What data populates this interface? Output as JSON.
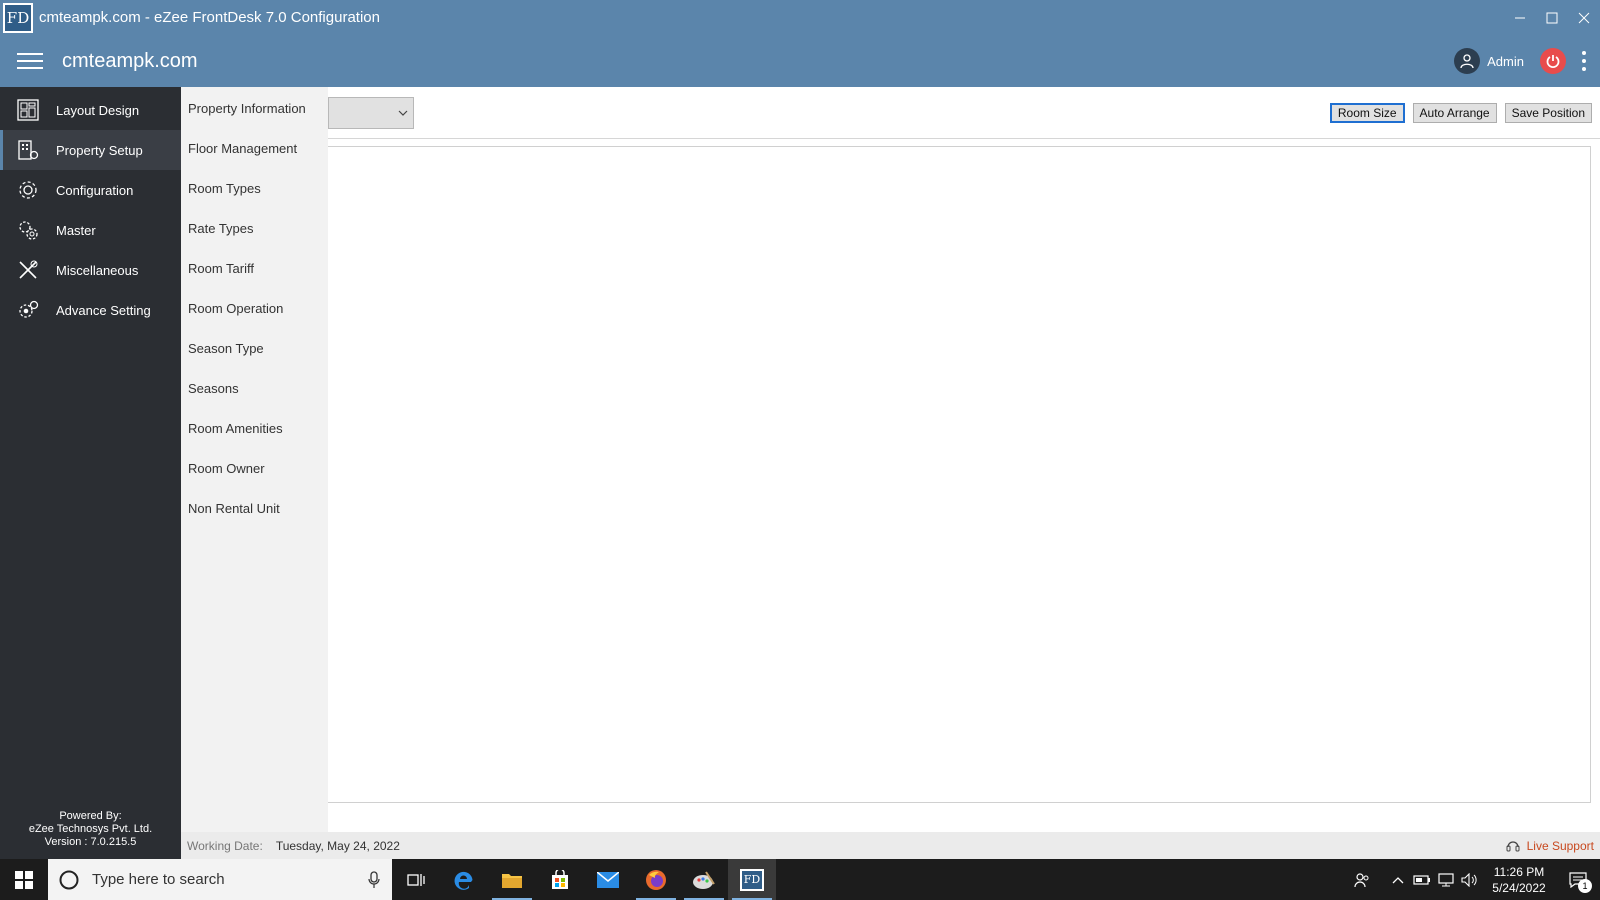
{
  "window": {
    "logo_text": "FD",
    "title": "cmteampk.com - eZee FrontDesk 7.0 Configuration"
  },
  "header": {
    "site_name": "cmteampk.com",
    "user_label": "Admin"
  },
  "sidebar": {
    "items": [
      {
        "label": "Layout Design",
        "icon": "layout-grid-icon"
      },
      {
        "label": "Property Setup",
        "icon": "building-icon",
        "active": true
      },
      {
        "label": "Configuration",
        "icon": "gear-icon"
      },
      {
        "label": "Master",
        "icon": "gears-icon"
      },
      {
        "label": "Miscellaneous",
        "icon": "tools-icon"
      },
      {
        "label": "Advance Setting",
        "icon": "advance-gear-icon"
      }
    ],
    "powered_by": {
      "line1": "Powered By:",
      "line2": "eZee Technosys Pvt. Ltd.",
      "line3": "Version : 7.0.215.5"
    }
  },
  "submenu": {
    "items": [
      "Property Information",
      "Floor Management",
      "Room Types",
      "Rate Types",
      "Room Tariff",
      "Room Operation",
      "Season Type",
      "Seasons",
      "Room Amenities",
      "Room Owner",
      "Non Rental Unit"
    ]
  },
  "toolbar": {
    "room_size": "Room Size",
    "auto_arrange": "Auto Arrange",
    "save_position": "Save Position"
  },
  "status": {
    "working_date_label": "Working Date:",
    "working_date_value": "Tuesday, May 24, 2022",
    "live_support": "Live Support"
  },
  "taskbar": {
    "search_placeholder": "Type here to search",
    "time": "11:26 PM",
    "date": "5/24/2022",
    "notification_count": "1"
  },
  "colors": {
    "header": "#5b85ab",
    "sidebar": "#2b2e33",
    "submenu": "#f2f2f2",
    "power": "#e84c4c",
    "live_support": "#c8491f"
  }
}
